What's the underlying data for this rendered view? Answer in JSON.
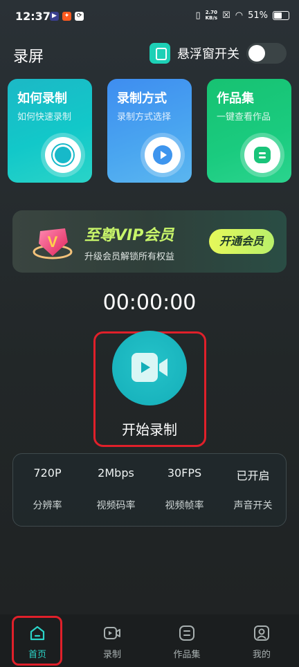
{
  "status_bar": {
    "time": "12:37",
    "speed_top": "2.70",
    "speed_bottom": "KB/s",
    "battery": "51%"
  },
  "header": {
    "title": "录屏",
    "float_toggle_label": "悬浮窗开关",
    "float_toggle_on": false
  },
  "cards": [
    {
      "title": "如何录制",
      "subtitle": "如何快速录制",
      "icon": "record-dot-icon"
    },
    {
      "title": "录制方式",
      "subtitle": "录制方式选择",
      "icon": "play-icon"
    },
    {
      "title": "作品集",
      "subtitle": "一键查看作品",
      "icon": "document-icon"
    }
  ],
  "vip": {
    "title": "至尊VIP会员",
    "subtitle": "升级会员解锁所有权益",
    "button": "开通会员",
    "badge_letter": "V"
  },
  "timer": "00:00:00",
  "record": {
    "label": "开始录制",
    "icon": "video-camera-icon"
  },
  "stats": [
    {
      "value": "720P",
      "label": "分辨率"
    },
    {
      "value": "2Mbps",
      "label": "视频码率"
    },
    {
      "value": "30FPS",
      "label": "视频帧率"
    },
    {
      "value": "已开启",
      "label": "声音开关"
    }
  ],
  "nav": [
    {
      "label": "首页",
      "icon": "home-icon",
      "active": true
    },
    {
      "label": "录制",
      "icon": "video-camera-icon",
      "active": false
    },
    {
      "label": "作品集",
      "icon": "document-icon",
      "active": false
    },
    {
      "label": "我的",
      "icon": "user-icon",
      "active": false
    }
  ],
  "colors": {
    "accent": "#2bd5c8",
    "highlight_box": "#e0202a",
    "vip_text": "#c8f56a"
  }
}
